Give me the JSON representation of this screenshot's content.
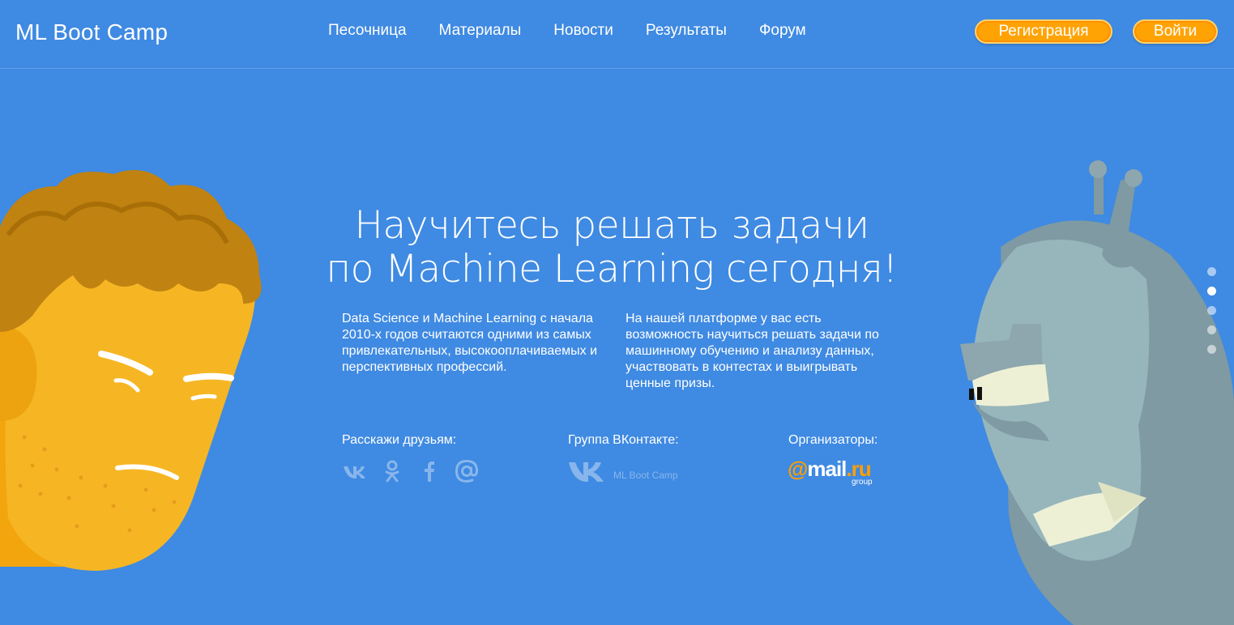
{
  "header": {
    "logo": "ML Boot Camp",
    "nav": [
      "Песочница",
      "Материалы",
      "Новости",
      "Результаты",
      "Форум"
    ],
    "register_label": "Регистрация",
    "login_label": "Войти"
  },
  "hero": {
    "title_line1": "Научитесь решать задачи",
    "title_line2": "по Machine Learning сегодня!",
    "paragraph_left": "Data Science и Machine Learning с начала 2010-х годов считаются одними из самых привлекательных, высокооплачиваемых и перспективных профессий.",
    "paragraph_right": "На нашей платформе у вас есть возможность научиться решать задачи по машинному обучению и анализу данных, участвовать в контестах и выигрывать ценные призы."
  },
  "footer_info": {
    "share_label": "Расскажи друзьям:",
    "share_icons": [
      "vk-icon",
      "odnoklassniki-icon",
      "facebook-icon",
      "mail-at-icon"
    ],
    "vk_group_label": "Группа ВКонтакте:",
    "vk_group_name": "ML Boot Camp",
    "organizers_label": "Организаторы:",
    "organizer_logo": {
      "part1": "@",
      "part2": "mail",
      "part3": ".ru",
      "sub": "group"
    }
  },
  "slider": {
    "count": 5,
    "active_index": 1
  },
  "colors": {
    "background": "#3f8ae2",
    "button": "#ffa305",
    "accent_orange": "#ff9e00",
    "muted_icon": "#88b6ec"
  }
}
